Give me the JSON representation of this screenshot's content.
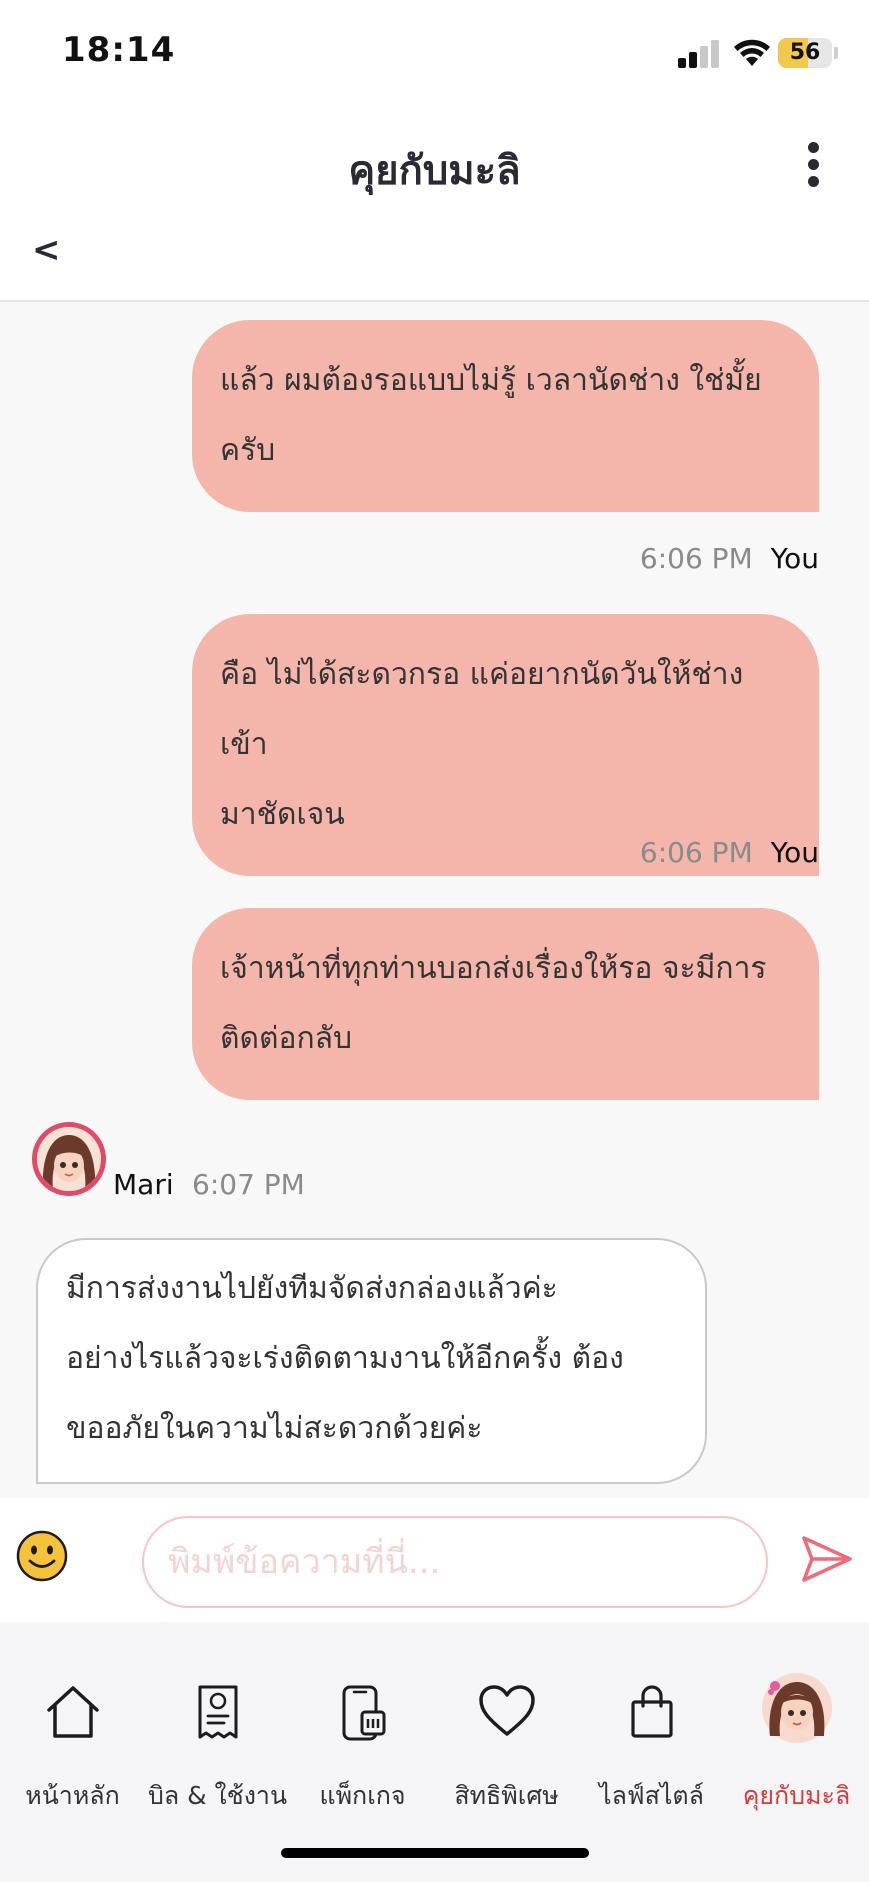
{
  "status_bar": {
    "time": "18:14",
    "battery": "56",
    "battery_level": 0.56
  },
  "header": {
    "title": "คุยกับมะลิ",
    "back_label": "<"
  },
  "messages": [
    {
      "role": "user",
      "text_line1": "แล้ว ผมต้องรอแบบไม่รู้ เวลานัดช่าง ใช่มั้ย",
      "text_line2": "ครับ",
      "time": "6:06 PM",
      "sender": "You"
    },
    {
      "role": "user",
      "text_line1": "คือ ไม่ได้สะดวกรอ แค่อยากนัดวันให้ช่างเข้า",
      "text_line2": "มาชัดเจน",
      "time": "6:06 PM",
      "sender": "You"
    },
    {
      "role": "user",
      "text_line1": "เจ้าหน้าที่ทุกท่านบอกส่งเรื่องให้รอ จะมีการ",
      "text_line2": "ติดต่อกลับ"
    },
    {
      "role": "bot",
      "sender": "Mari",
      "time": "6:07 PM",
      "text_line1": "มีการส่งงานไปยังทีมจัดส่งกล่องแล้วค่ะ",
      "text_line2": "อย่างไรแล้วจะเร่งติดตามงานให้อีกครั้ง ต้อง",
      "text_line3": "ขออภัยในความไม่สะดวกด้วยค่ะ"
    }
  ],
  "input": {
    "placeholder": "พิมพ์ข้อความที่นี่..."
  },
  "nav": {
    "items": [
      {
        "label": "หน้าหลัก",
        "icon": "home-icon"
      },
      {
        "label": "บิล & ใช้งาน",
        "icon": "bill-icon"
      },
      {
        "label": "แพ็กเกจ",
        "icon": "package-phone-icon"
      },
      {
        "label": "สิทธิพิเศษ",
        "icon": "heart-icon"
      },
      {
        "label": "ไลฟ์สไตล์",
        "icon": "shopping-bag-icon"
      },
      {
        "label": "คุยกับมะลิ",
        "icon": "mari-avatar-icon",
        "active": true
      }
    ]
  },
  "colors": {
    "user_bubble": "#f4b6aa",
    "active_nav": "#d63a3a",
    "send": "#ee6b7a"
  }
}
